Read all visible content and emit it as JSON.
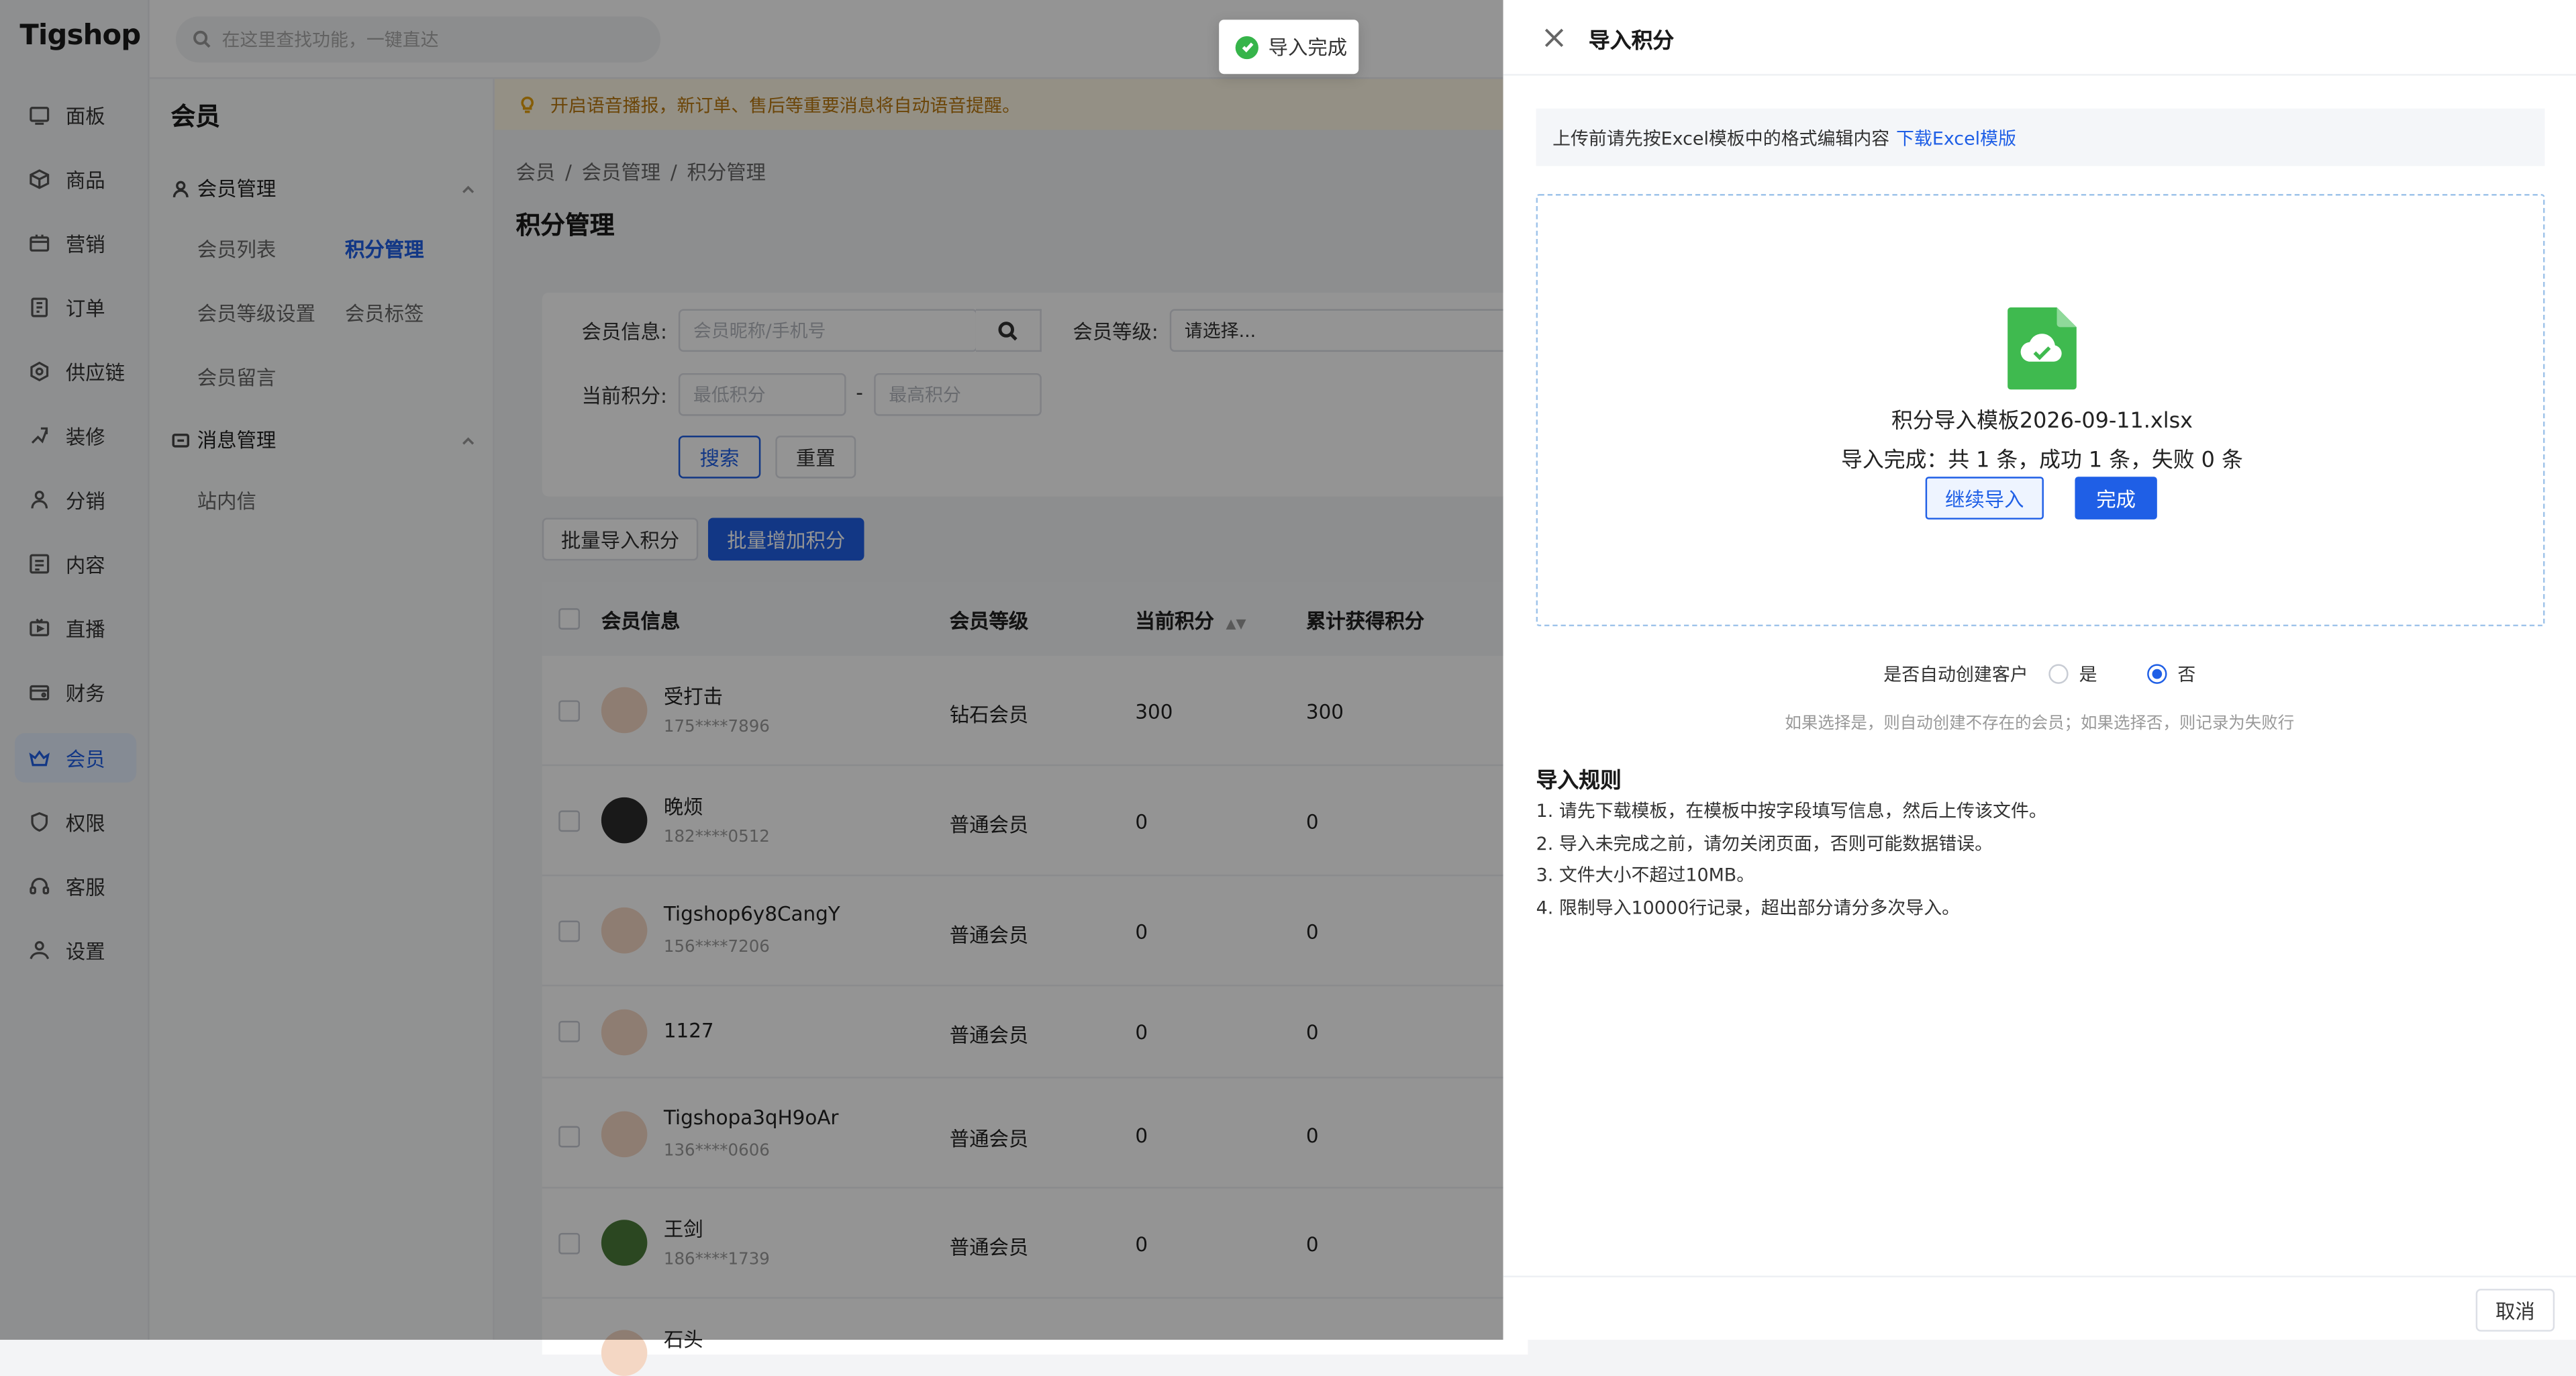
{
  "app": {
    "logo": "Tigshop"
  },
  "topbar": {
    "search_placeholder": "在这里查找功能，一键直达"
  },
  "rail": {
    "items": [
      {
        "label": "面板",
        "icon": "dashboard-icon"
      },
      {
        "label": "商品",
        "icon": "box-icon"
      },
      {
        "label": "营销",
        "icon": "marketing-icon"
      },
      {
        "label": "订单",
        "icon": "order-icon"
      },
      {
        "label": "供应链",
        "icon": "supply-chain-icon"
      },
      {
        "label": "装修",
        "icon": "decoration-icon"
      },
      {
        "label": "分销",
        "icon": "distribution-icon"
      },
      {
        "label": "内容",
        "icon": "content-icon"
      },
      {
        "label": "直播",
        "icon": "live-icon"
      },
      {
        "label": "财务",
        "icon": "finance-icon"
      },
      {
        "label": "会员",
        "icon": "member-icon",
        "active": true
      },
      {
        "label": "权限",
        "icon": "shield-icon"
      },
      {
        "label": "客服",
        "icon": "customer-service-icon"
      },
      {
        "label": "设置",
        "icon": "settings-icon"
      }
    ]
  },
  "subsidebar": {
    "title": "会员",
    "group1": "会员管理",
    "links": [
      "会员列表",
      "积分管理",
      "会员等级设置",
      "会员标签",
      "会员留言"
    ],
    "group2": "消息管理",
    "links2": [
      "站内信"
    ]
  },
  "notice": "开启语音播报，新订单、售后等重要消息将自动语音提醒。",
  "breadcrumb": [
    "会员",
    "/",
    "会员管理",
    "/",
    "积分管理"
  ],
  "page_title": "积分管理",
  "filter": {
    "member_label": "会员信息:",
    "member_placeholder": "会员昵称/手机号",
    "level_label": "会员等级:",
    "level_value": "请选择...",
    "points_label": "当前积分:",
    "min_placeholder": "最低积分",
    "dash": "-",
    "max_placeholder": "最高积分",
    "search_btn": "搜索",
    "reset_btn": "重置"
  },
  "actions": {
    "batch_import": "批量导入积分",
    "batch_add": "批量增加积分"
  },
  "table": {
    "headers": [
      "会员信息",
      "会员等级",
      "当前积分",
      "累计获得积分"
    ],
    "rows": [
      {
        "name": "受打击",
        "phone": "175****7896",
        "level": "钻石会员",
        "points": "300",
        "total": "300"
      },
      {
        "name": "晚烦",
        "phone": "182****0512",
        "level": "普通会员",
        "points": "0",
        "total": "0"
      },
      {
        "name": "Tigshop6y8CangY",
        "phone": "156****7206",
        "level": "普通会员",
        "points": "0",
        "total": "0"
      },
      {
        "name": "1127",
        "phone": "",
        "level": "普通会员",
        "points": "0",
        "total": "0"
      },
      {
        "name": "Tigshopa3qH9oAr",
        "phone": "136****0606",
        "level": "普通会员",
        "points": "0",
        "total": "0"
      },
      {
        "name": "王剑",
        "phone": "186****1739",
        "level": "普通会员",
        "points": "0",
        "total": "0"
      },
      {
        "name": "石头",
        "phone": "",
        "level": "",
        "points": "",
        "total": ""
      }
    ]
  },
  "toast": {
    "text": "导入完成"
  },
  "drawer": {
    "title": "导入积分",
    "tip_text": "上传前请先按Excel模板中的格式编辑内容",
    "tip_link": "下载Excel模版",
    "file_name": "积分导入模板2026-09-11.xlsx",
    "result": "导入完成：共 1 条，成功 1 条，失败 0 条",
    "continue_btn": "继续导入",
    "done_btn": "完成",
    "auto_create_label": "是否自动创建客户",
    "opt_yes": "是",
    "opt_no": "否",
    "hint": "如果选择是，则自动创建不存在的会员；如果选择否，则记录为失败行",
    "rules_title": "导入规则",
    "rules": [
      "1. 请先下载模板，在模板中按字段填写信息，然后上传该文件。",
      "2. 导入未完成之前，请勿关闭页面，否则可能数据错误。",
      "3. 文件大小不超过10MB。",
      "4. 限制导入10000行记录，超出部分请分多次导入。"
    ],
    "cancel_btn": "取消"
  },
  "colors": {
    "accent": "#1f5fe6",
    "success": "#36b44a",
    "file_green": "#3fba4f"
  }
}
